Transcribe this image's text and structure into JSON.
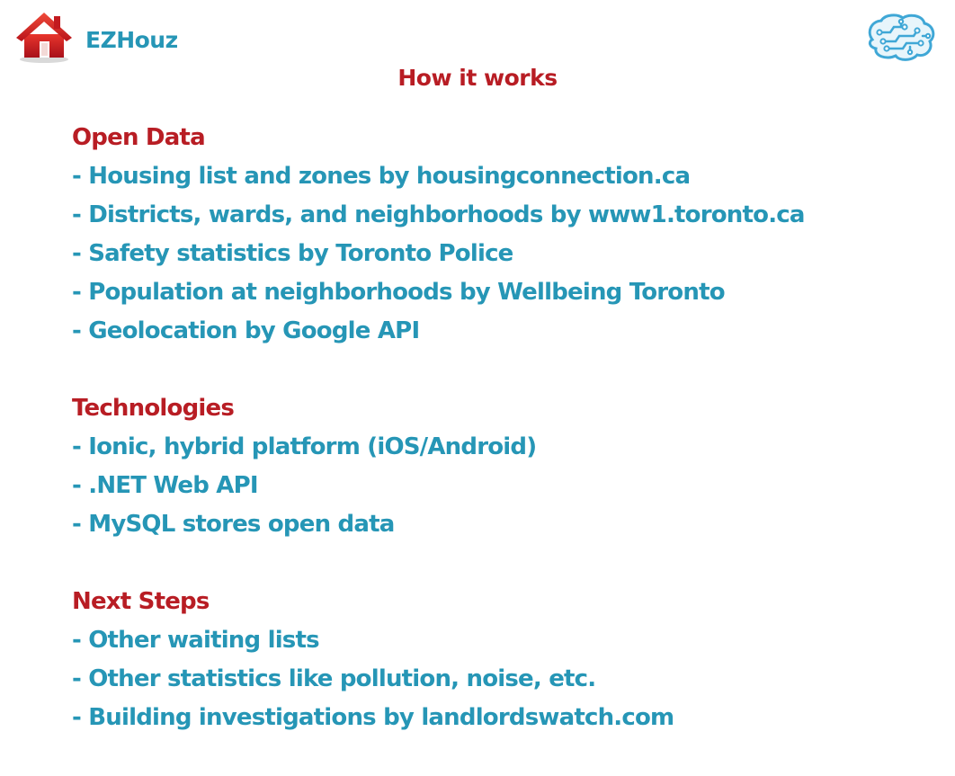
{
  "header": {
    "brand": "EZHouz",
    "title": "How it works",
    "logo_icon": "house-icon",
    "brain_icon": "circuit-brain-icon"
  },
  "colors": {
    "heading": "#b81d24",
    "text": "#2696b6",
    "house_red": "#d42020",
    "brain_blue": "#3fa7d6"
  },
  "sections": [
    {
      "heading": "Open Data",
      "items": [
        "- Housing list and zones by housingconnection.ca",
        "- Districts, wards, and neighborhoods by www1.toronto.ca",
        "- Safety statistics by Toronto Police",
        "- Population at neighborhoods by Wellbeing Toronto",
        "- Geolocation by Google API"
      ]
    },
    {
      "heading": "Technologies",
      "items": [
        "- Ionic, hybrid platform (iOS/Android)",
        "- .NET Web API",
        "- MySQL stores open data"
      ]
    },
    {
      "heading": "Next Steps",
      "items": [
        "- Other waiting lists",
        "- Other statistics like pollution, noise, etc.",
        "- Building investigations by landlordswatch.com"
      ]
    }
  ]
}
